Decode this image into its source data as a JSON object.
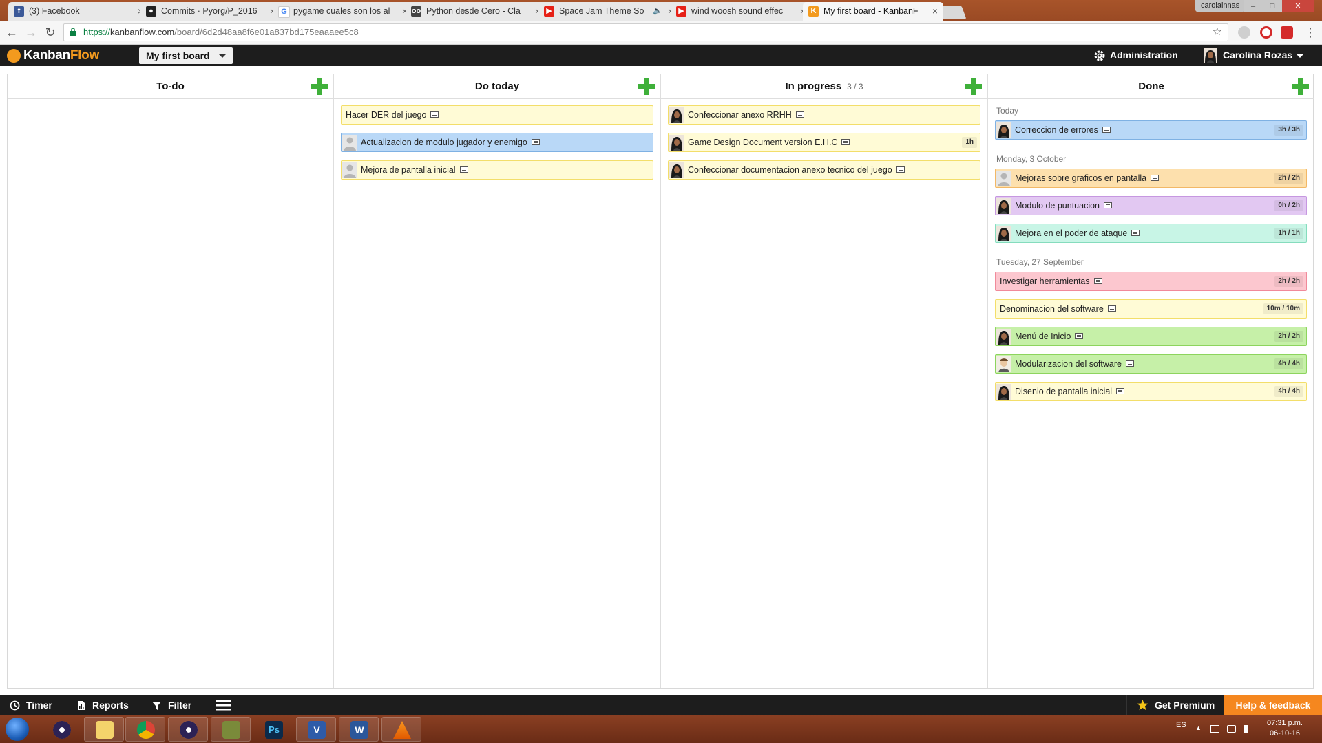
{
  "browser": {
    "tabs": [
      {
        "title": "(3) Facebook",
        "icon": "facebook-icon",
        "active": false
      },
      {
        "title": "Commits · Pyorg/P_2016",
        "icon": "github-icon",
        "active": false
      },
      {
        "title": "pygame cuales son los al",
        "icon": "google-icon",
        "active": false
      },
      {
        "title": "Python desde Cero - Cla",
        "icon": "glasses-icon",
        "active": false
      },
      {
        "title": "Space Jam Theme So",
        "icon": "youtube-icon",
        "active": false,
        "audio": true
      },
      {
        "title": "wind woosh sound effec",
        "icon": "youtube-icon",
        "active": false
      },
      {
        "title": "My first board - KanbanF",
        "icon": "kanbanflow-icon",
        "active": true
      }
    ],
    "window_user": "carolainnas",
    "url_scheme": "https://",
    "url_host": "kanbanflow.com",
    "url_path": "/board/6d2d48aa8f6e01a837bd175eaaaee5c8"
  },
  "app": {
    "logo_kanban": "Kanban",
    "logo_flow": "Flow",
    "board_name": "My first board",
    "admin_label": "Administration",
    "user_name": "Carolina Rozas"
  },
  "columns": [
    {
      "name": "To-do",
      "wip": "",
      "groups": []
    },
    {
      "name": "Do today",
      "wip": "",
      "groups": [
        {
          "label": "",
          "tasks": [
            {
              "title": "Hacer DER del juego",
              "color": "yellow",
              "avatar": "none",
              "time": ""
            },
            {
              "title": "Actualizacion de modulo jugador y enemigo",
              "color": "blue",
              "avatar": "placeholder",
              "time": ""
            },
            {
              "title": "Mejora de pantalla inicial",
              "color": "yellow",
              "avatar": "placeholder",
              "time": ""
            }
          ]
        }
      ]
    },
    {
      "name": "In progress",
      "wip": "3 / 3",
      "groups": [
        {
          "label": "",
          "tasks": [
            {
              "title": "Confeccionar anexo RRHH",
              "color": "yellow",
              "avatar": "user",
              "time": ""
            },
            {
              "title": "Game Design Document version E.H.C",
              "color": "yellow",
              "avatar": "user",
              "time": "1h"
            },
            {
              "title": "Confeccionar documentacion anexo tecnico del juego",
              "color": "yellow",
              "avatar": "user",
              "time": ""
            }
          ]
        }
      ]
    },
    {
      "name": "Done",
      "wip": "",
      "groups": [
        {
          "label": "Today",
          "tasks": [
            {
              "title": "Correccion de errores",
              "color": "blue",
              "avatar": "user",
              "time": "3h / 3h"
            }
          ]
        },
        {
          "label": "Monday, 3 October",
          "tasks": [
            {
              "title": "Mejoras sobre graficos en pantalla",
              "color": "orange",
              "avatar": "placeholder",
              "time": "2h / 2h"
            },
            {
              "title": "Modulo de puntuacion",
              "color": "purple",
              "avatar": "user",
              "time": "0h / 2h"
            },
            {
              "title": "Mejora en el poder de ataque",
              "color": "mint",
              "avatar": "user",
              "time": "1h / 1h"
            }
          ]
        },
        {
          "label": "Tuesday, 27 September",
          "tasks": [
            {
              "title": "Investigar herramientas",
              "color": "pink",
              "avatar": "none",
              "time": "2h / 2h"
            },
            {
              "title": "Denominacion del software",
              "color": "yellow",
              "avatar": "none",
              "time": "10m / 10m"
            },
            {
              "title": "Menú de Inicio",
              "color": "green",
              "avatar": "user",
              "time": "2h / 2h"
            },
            {
              "title": "Modularizacion del software",
              "color": "green",
              "avatar": "man",
              "time": "4h / 4h"
            },
            {
              "title": "Disenio de pantalla inicial",
              "color": "yellow",
              "avatar": "user",
              "time": "4h / 4h"
            }
          ]
        }
      ]
    }
  ],
  "bottom": {
    "timer": "Timer",
    "reports": "Reports",
    "filter": "Filter",
    "premium": "Get Premium",
    "help": "Help & feedback"
  },
  "taskbar": {
    "lang": "ES",
    "time": "07:31 p.m.",
    "date": "06-10-16"
  },
  "colors": {
    "accent_orange": "#f5871f",
    "add_green": "#3fb03a",
    "header_dark": "#1d1d1d"
  }
}
